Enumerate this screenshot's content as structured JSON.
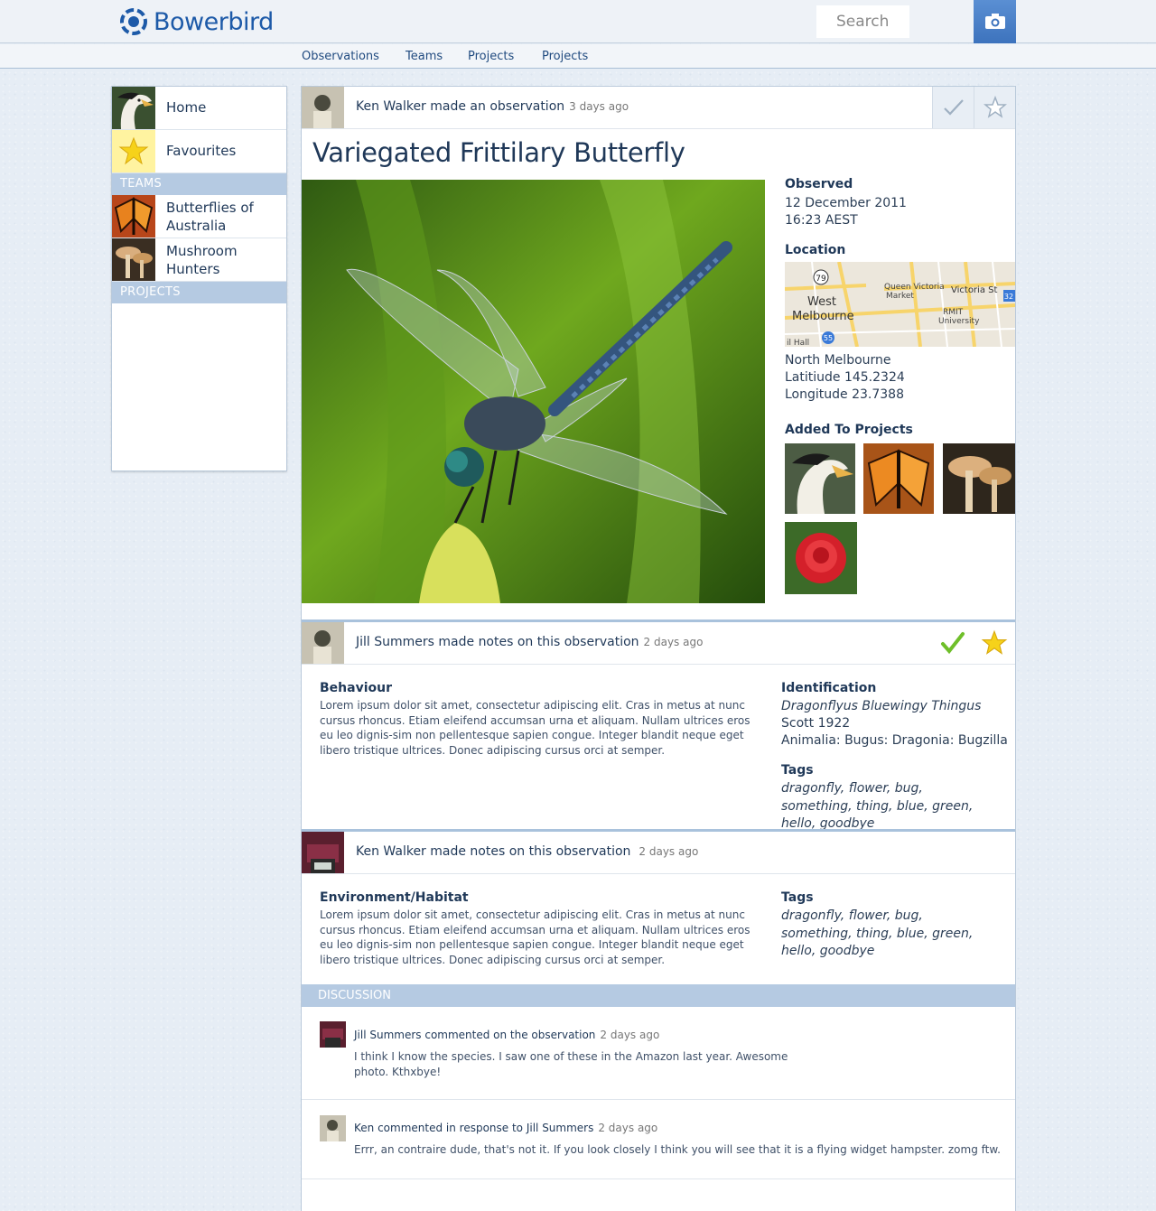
{
  "header": {
    "logo_text": "Bowerbird",
    "search_placeholder": "Search",
    "nav": [
      "Observations",
      "Teams",
      "Projects",
      "Projects"
    ]
  },
  "sidebar": {
    "items": [
      {
        "label": "Home"
      },
      {
        "label": "Favourites"
      }
    ],
    "teams_header": "TEAMS",
    "teams": [
      {
        "label": "Butterflies of Australia"
      },
      {
        "label": "Mushroom Hunters"
      }
    ],
    "projects_header": "PROJECTS"
  },
  "observation": {
    "activity": {
      "who": "Ken Walker made an observation",
      "when": "3 days ago"
    },
    "title": "Variegated Frittilary Butterfly",
    "observed_label": "Observed",
    "observed_date": "12 December 2011",
    "observed_time": "16:23 AEST",
    "location_label": "Location",
    "map_labels": {
      "west_melbourne": "West Melbourne",
      "queen_victoria_market": "Queen Victoria Market",
      "rmit": "RMIT University",
      "victoria_st": "Victoria St",
      "hall": "il Hall",
      "route_79": "79",
      "route_55": "55",
      "route_32": "32"
    },
    "location_name": "North  Melbourne",
    "latitude": "Latitiude 145.2324",
    "longitude": "Longitude 23.7388",
    "projects_label": "Added To Projects"
  },
  "notes": [
    {
      "who": "Jill Summers made notes on this observation",
      "when": "2 days ago",
      "heading": "Behaviour",
      "text": "Lorem ipsum dolor sit amet, consectetur adipiscing elit. Cras in metus at nunc cursus rhoncus. Etiam eleifend accumsan urna et aliquam. Nullam ultrices eros eu leo dignis-sim non pellentesque sapien congue. Integer blandit neque eget libero tristique ultrices. Donec adipiscing cursus orci at semper.",
      "identification_label": "Identification",
      "identification_name": "Dragonflyus Bluewingy Thingus",
      "identification_author": "Scott 1922",
      "identification_taxonomy": "Animalia: Bugus: Dragonia: Bugzilla",
      "tags_label": "Tags",
      "tags": "dragonfly, flower, bug, something, thing, blue, green, hello, goodbye"
    },
    {
      "who": "Ken Walker made notes on this observation",
      "when": "2 days ago",
      "heading": "Environment/Habitat",
      "text": "Lorem ipsum dolor sit amet, consectetur adipiscing elit. Cras in metus at nunc cursus rhoncus. Etiam eleifend accumsan urna et aliquam. Nullam ultrices eros eu leo dignis-sim non pellentesque sapien congue. Integer blandit neque eget libero tristique ultrices. Donec adipiscing cursus orci at semper.",
      "tags_label": "Tags",
      "tags": "dragonfly, flower, bug, something, thing, blue, green, hello, goodbye"
    }
  ],
  "discussion": {
    "header": "DISCUSSION",
    "comments": [
      {
        "who": "Jill Summers commented on the observation",
        "when": "2 days ago",
        "text": "I think I know the species. I saw one of these in the Amazon last year. Awesome photo. Kthxbye!"
      },
      {
        "who": "Ken commented in response to Jill Summers",
        "when": "2 days ago",
        "text": "Errr, an contraire dude, that's not it. If you look closely I think you will see that it is a flying widget hampster. zomg ftw."
      }
    ]
  },
  "colors": {
    "brand": "#1d5aa8",
    "accent_blue": "#b5cae2",
    "check_green": "#6fbf2a",
    "star_yellow": "#f6d21a"
  },
  "icons": [
    "logo-icon",
    "camera-icon",
    "checkmark-icon",
    "star-icon"
  ]
}
